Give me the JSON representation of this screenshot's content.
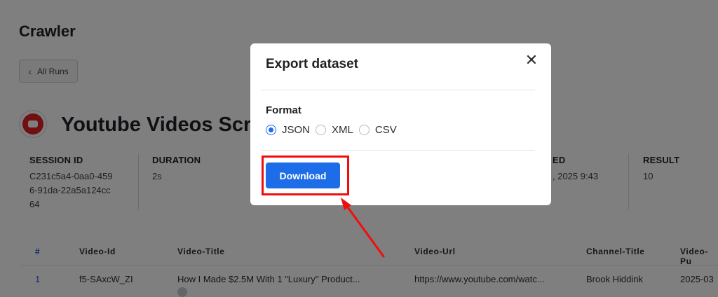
{
  "page": {
    "title": "Crawler",
    "back_label": "All Runs",
    "actor_name": "Youtube Videos Scra"
  },
  "stats": [
    {
      "label": "SESSION ID",
      "value": "C231c5a4-0aa0-4596-91da-22a5a124cc64"
    },
    {
      "label": "DURATION",
      "value": "2s"
    },
    {
      "label": "ED",
      "value": ", 2025 9:43"
    },
    {
      "label": "RESULT",
      "value": "10"
    }
  ],
  "table": {
    "headers": [
      "#",
      "Video-Id",
      "Video-Title",
      "Video-Url",
      "Channel-Title",
      "Video-Pu"
    ],
    "rows": [
      [
        "1",
        "f5-SAxcW_ZI",
        "How I Made $2.5M With 1 \"Luxury\" Product...",
        "https://www.youtube.com/watc...",
        "Brook Hiddink",
        "2025-03"
      ]
    ]
  },
  "modal": {
    "title": "Export dataset",
    "close_symbol": "✕",
    "format_label": "Format",
    "options": [
      {
        "label": "JSON",
        "selected": true
      },
      {
        "label": "XML",
        "selected": false
      },
      {
        "label": "CSV",
        "selected": false
      }
    ],
    "download_label": "Download"
  },
  "colors": {
    "accent": "#1e6de8",
    "highlight": "#f20d0d",
    "youtube": "#e02020"
  }
}
